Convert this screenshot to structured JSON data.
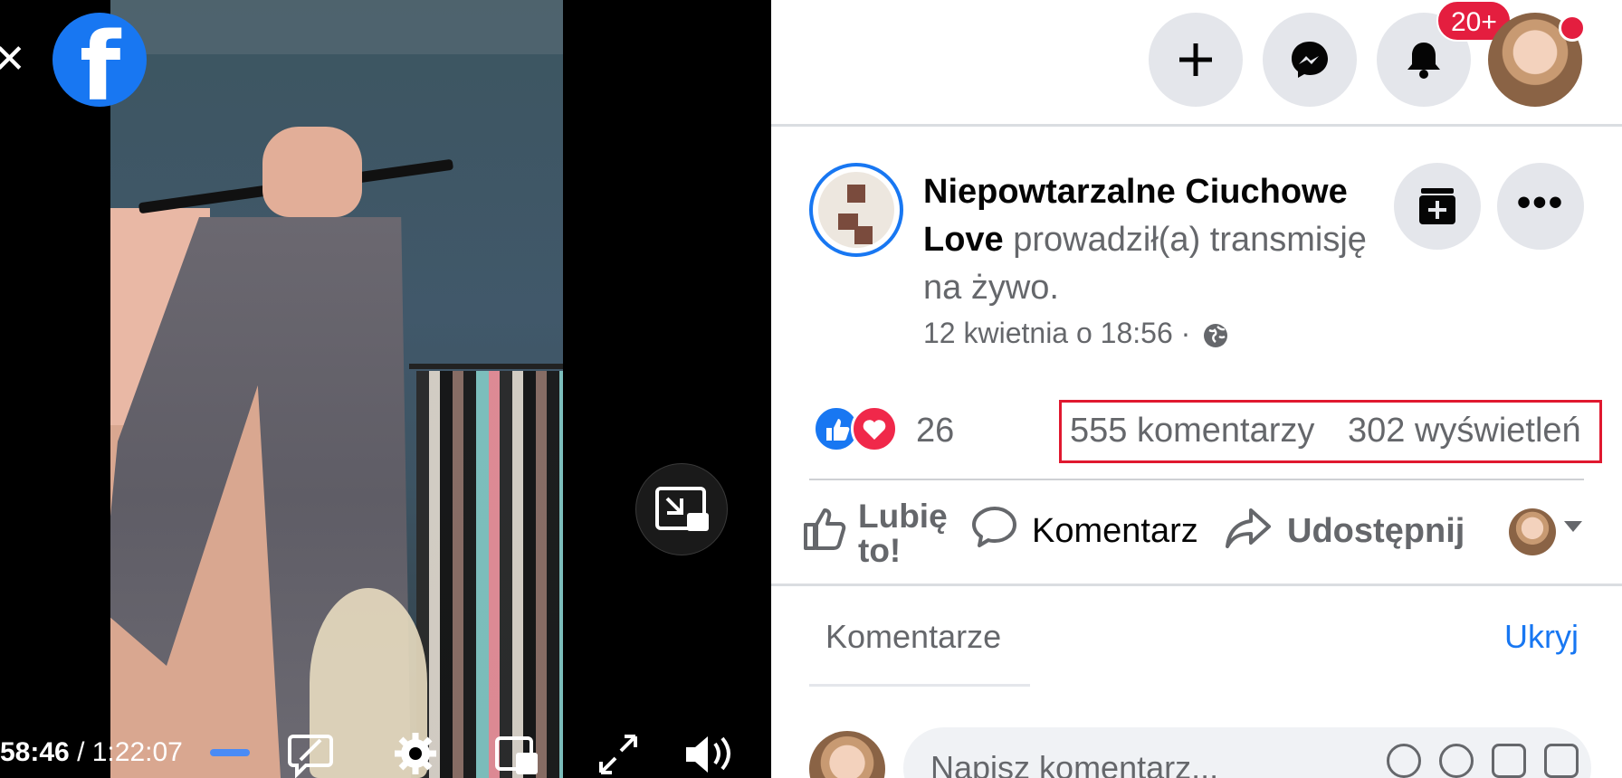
{
  "video": {
    "elapsed": "58:46",
    "separator": " / ",
    "duration": "1:22:07",
    "progress_fraction": 0.72
  },
  "topbar": {
    "notification_badge": "20+"
  },
  "post": {
    "page_name": "Niepowtarzalne Ciuchowe Love",
    "action_text": " prowadził(a) transmisję na żywo.",
    "date": "12 kwietnia o 18:56 · ",
    "reaction_count": "26",
    "comments_count": "555 komentarzy",
    "views_count": "302 wyświetleń"
  },
  "actions": {
    "like_label": "Lubię to!",
    "comment_label": "Komentarz",
    "share_label": "Udostępnij"
  },
  "comments": {
    "tab_label": "Komentarze",
    "hide_label": "Ukryj",
    "input_placeholder": "Napisz komentarz..."
  },
  "colors": {
    "brand": "#1877f2",
    "highlight_box": "#e0182f",
    "badge": "#e41e3f"
  },
  "icons": [
    "close-icon",
    "facebook-logo-icon",
    "picture-in-picture-icon",
    "captions-off-icon",
    "settings-icon",
    "pip-mini-icon",
    "fullscreen-icon",
    "volume-icon",
    "plus-icon",
    "messenger-icon",
    "bell-icon",
    "save-icon",
    "more-icon",
    "globe-icon",
    "like-reaction-icon",
    "love-reaction-icon",
    "thumbs-up-icon",
    "comment-icon",
    "share-icon",
    "chevron-down-icon"
  ]
}
